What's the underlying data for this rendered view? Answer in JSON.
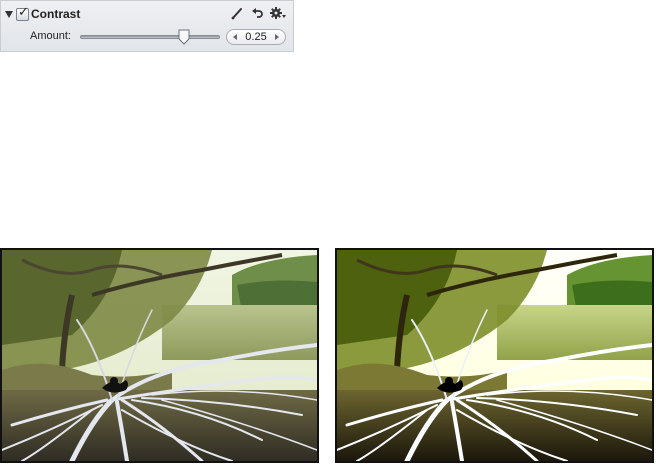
{
  "panel": {
    "title": "Contrast",
    "enabled": true,
    "amount_label": "Amount:",
    "amount_value": "0.25",
    "slider_fraction": 0.74,
    "icons": [
      "disclosure-triangle-icon",
      "brush-icon",
      "reset-arrow-icon",
      "gear-icon"
    ]
  },
  "photos": [
    {
      "name": "before",
      "filter": "none"
    },
    {
      "name": "after",
      "filter": "contrast(1.25) saturate(1.15)"
    }
  ],
  "colors": {
    "panel_bg": "#e6e8ec",
    "sky": "#e9f0d6",
    "foliage": "#6f7d3a",
    "water": "#a8b37b",
    "branches": "#e5e7ee"
  }
}
